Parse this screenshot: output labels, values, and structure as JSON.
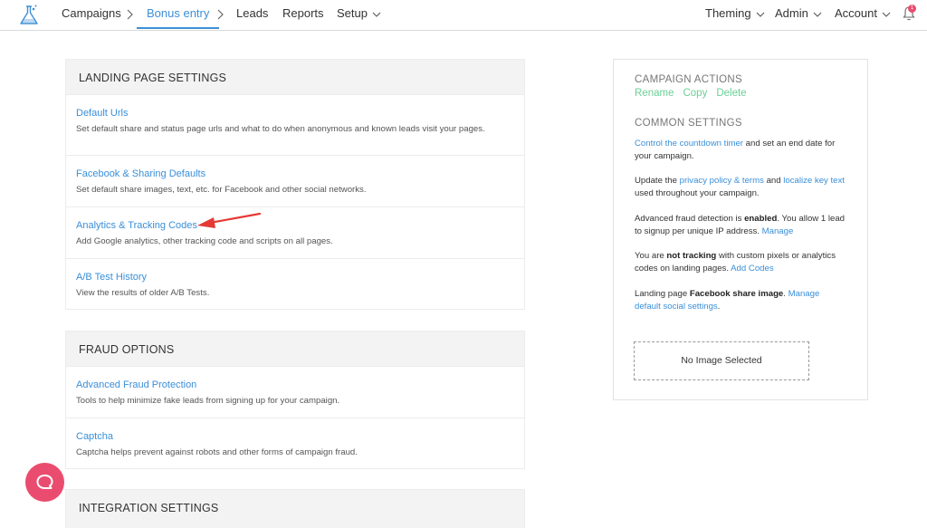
{
  "nav": {
    "campaigns": "Campaigns",
    "bonus_entry": "Bonus entry",
    "leads": "Leads",
    "reports": "Reports",
    "setup": "Setup",
    "theming": "Theming",
    "admin": "Admin",
    "account": "Account",
    "notification_count": "1"
  },
  "landing": {
    "heading": "LANDING PAGE SETTINGS",
    "items": [
      {
        "title": "Default Urls",
        "desc": "Set default share and status page urls and what to do when anonymous and known leads visit your pages."
      },
      {
        "title": "Facebook & Sharing Defaults",
        "desc": "Set default share images, text, etc. for Facebook and other social networks."
      },
      {
        "title": "Analytics & Tracking Codes",
        "desc": "Add Google analytics, other tracking code and scripts on all pages."
      },
      {
        "title": "A/B Test History",
        "desc": "View the results of older A/B Tests."
      }
    ]
  },
  "fraud": {
    "heading": "FRAUD OPTIONS",
    "items": [
      {
        "title": "Advanced Fraud Protection",
        "desc": "Tools to help minimize fake leads from signing up for your campaign."
      },
      {
        "title": "Captcha",
        "desc": "Captcha helps prevent against robots and other forms of campaign fraud."
      }
    ]
  },
  "integration": {
    "heading": "INTEGRATION SETTINGS"
  },
  "panel": {
    "campaign_actions": "CAMPAIGN ACTIONS",
    "rename": "Rename",
    "copy": "Copy",
    "delete": "Delete",
    "common_settings": "COMMON SETTINGS",
    "countdown_link": "Control the countdown timer",
    "countdown_text": " and set an end date for your campaign.",
    "privacy_pre": "Update the ",
    "privacy_link": "privacy policy & terms",
    "privacy_and": " and ",
    "localize_link": "localize key text",
    "privacy_post": " used throughout your campaign.",
    "fraud_pre": "Advanced fraud detection is ",
    "fraud_bold": "enabled",
    "fraud_post": ". You allow 1 lead to signup per unique IP address. ",
    "fraud_link": "Manage",
    "tracking_pre": "You are ",
    "tracking_bold": "not tracking",
    "tracking_post": " with custom pixels or analytics codes on landing pages. ",
    "tracking_link": "Add Codes",
    "share_pre": "Landing page ",
    "share_bold": "Facebook share image",
    "share_post": ". ",
    "share_link": "Manage default social settings",
    "share_end": ".",
    "no_image": "No Image Selected"
  },
  "colors": {
    "link": "#3a8fd9",
    "action": "#6ccf96",
    "accent": "#ea4c6f",
    "arrow": "#e53935"
  }
}
